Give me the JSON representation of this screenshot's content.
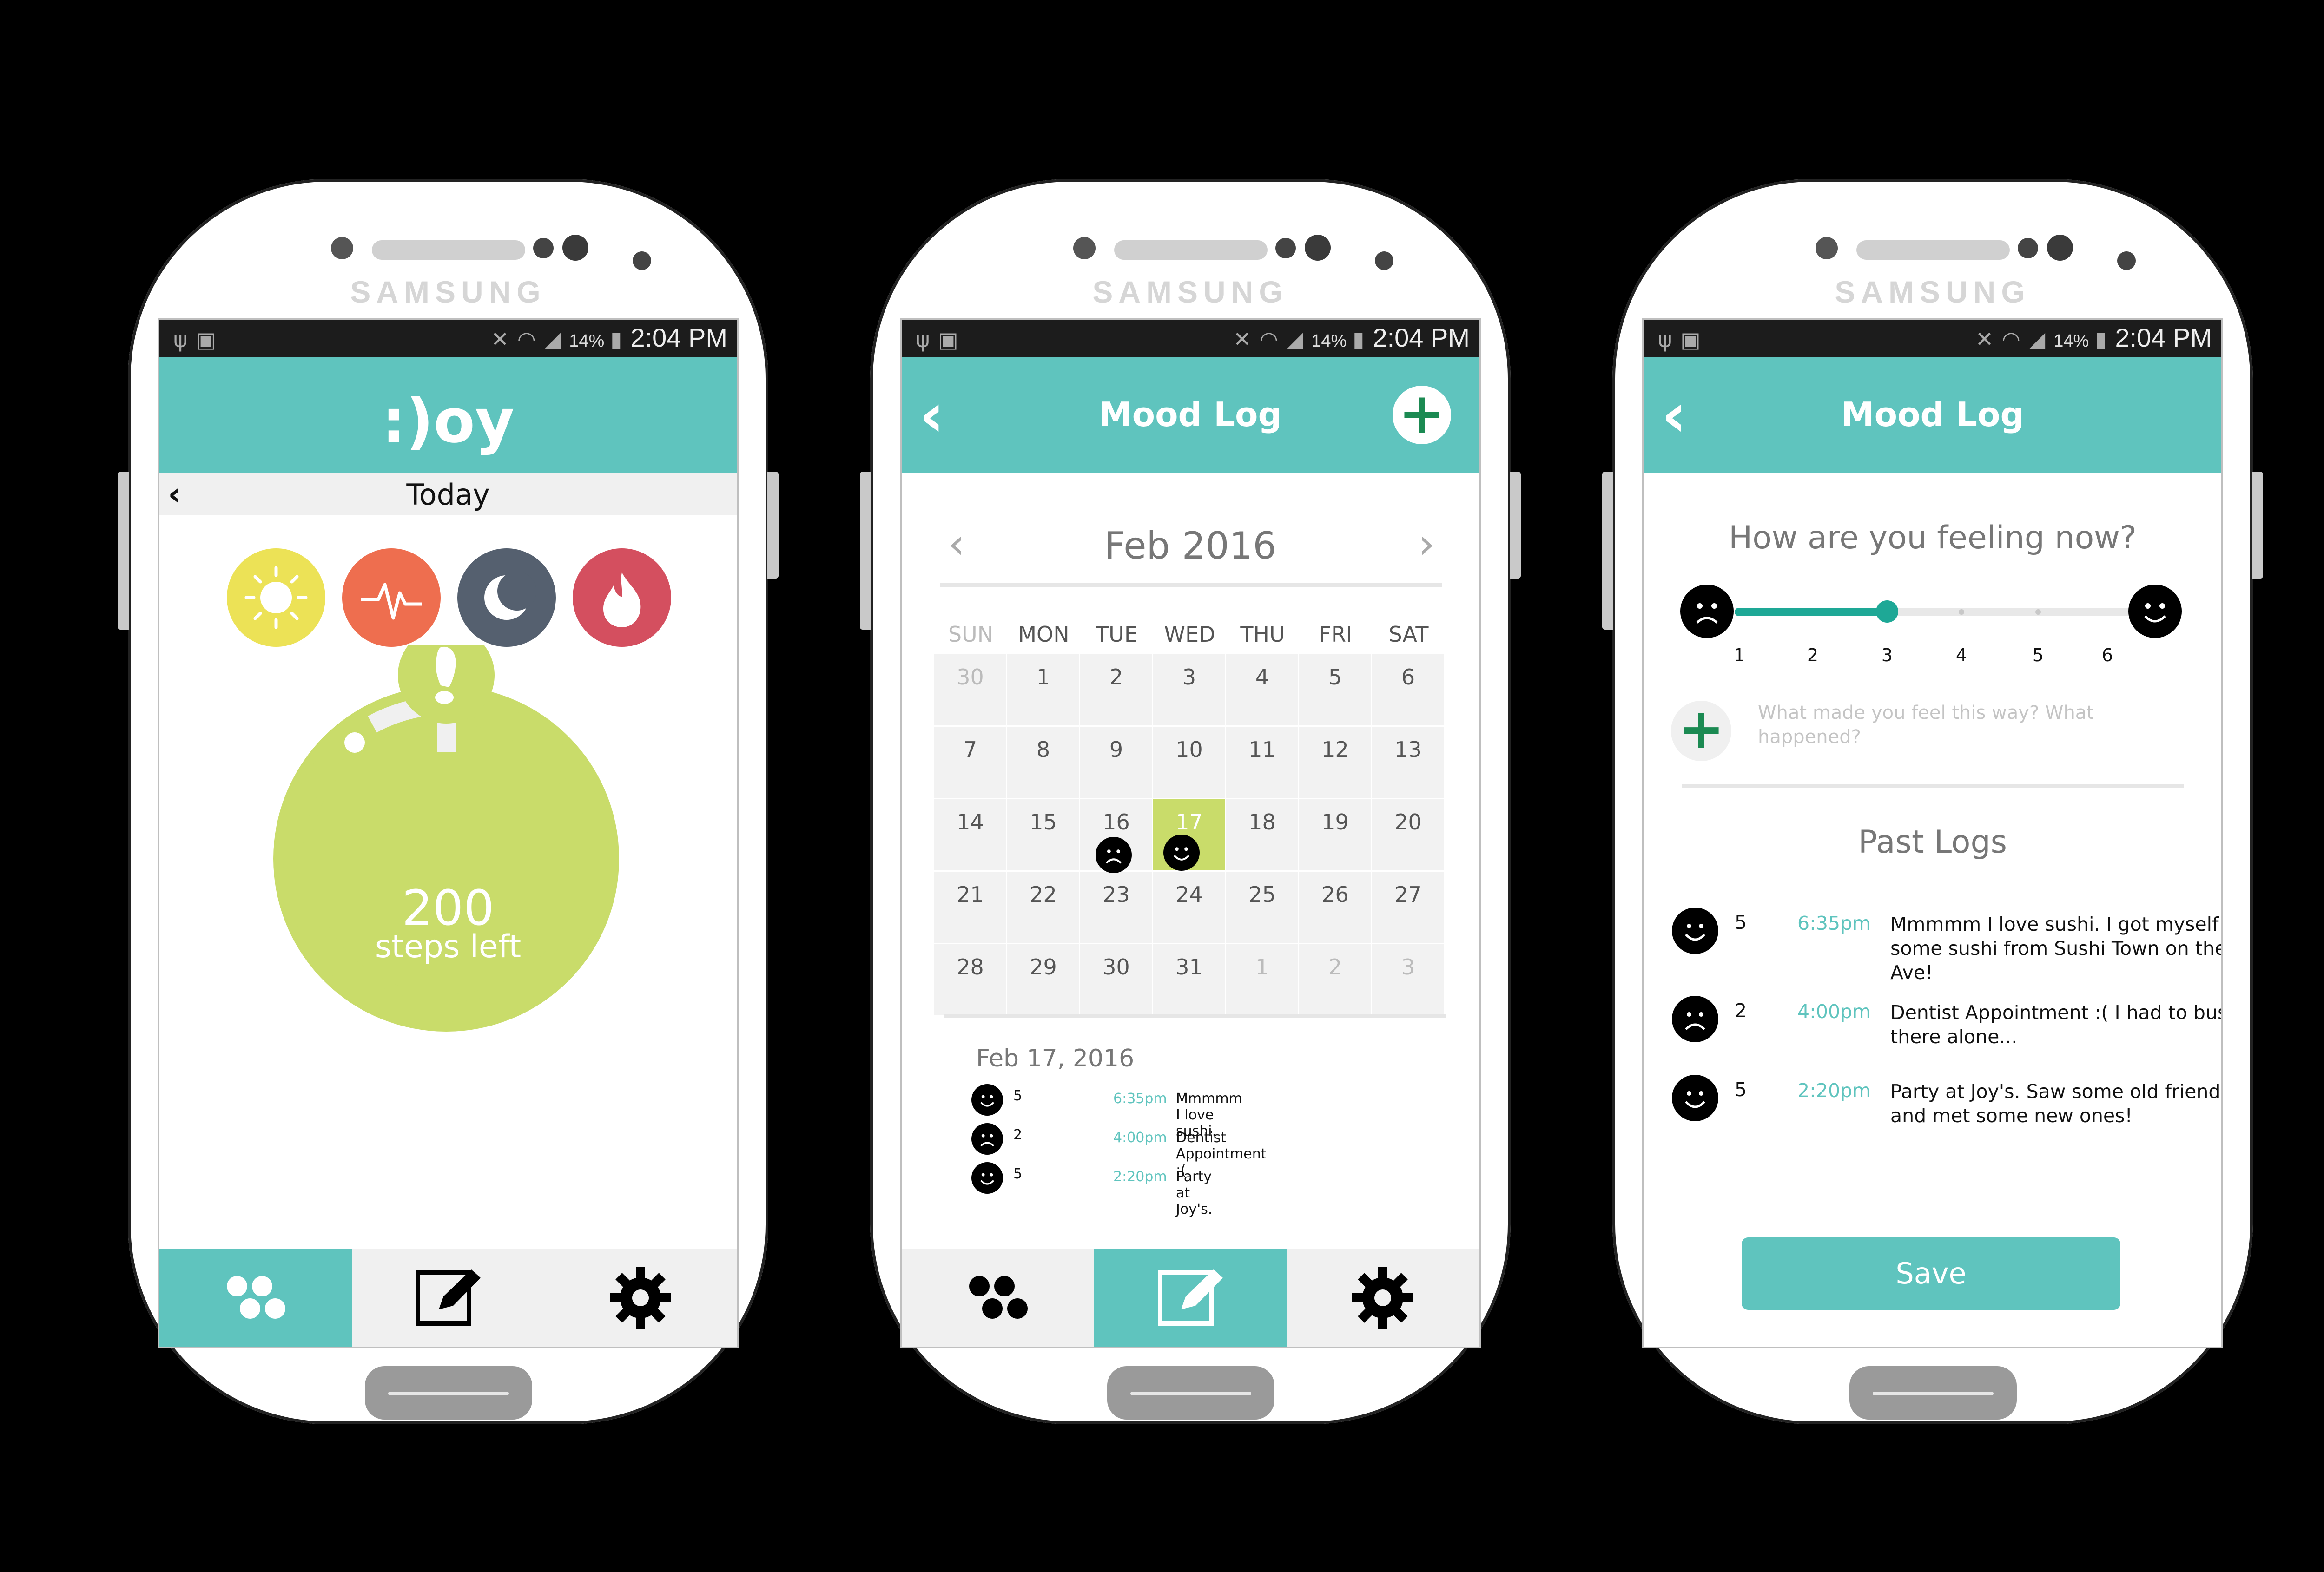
{
  "brand": "SAMSUNG",
  "status": {
    "battery": "14%",
    "time": "2:04 PM"
  },
  "screen1": {
    "logo": ":)oy",
    "today_label": "Today",
    "activity_icons": [
      {
        "name": "sun-icon",
        "color": "#ece256"
      },
      {
        "name": "heartbeat-icon",
        "color": "#ee6e4f"
      },
      {
        "name": "moon-icon",
        "color": "#55606f"
      },
      {
        "name": "flame-icon",
        "color": "#d44f5f"
      }
    ],
    "steps_value": "200",
    "steps_label": "steps left",
    "steps_progress": 0.92,
    "accent": "#c9dc6a"
  },
  "screen2": {
    "title": "Mood Log",
    "month": "Feb 2016",
    "weekdays": [
      "SUN",
      "MON",
      "TUE",
      "WED",
      "THU",
      "FRI",
      "SAT"
    ],
    "weeks": [
      [
        "30",
        "1",
        "2",
        "3",
        "4",
        "5",
        "6"
      ],
      [
        "7",
        "8",
        "9",
        "10",
        "11",
        "12",
        "13"
      ],
      [
        "14",
        "15",
        "16",
        "17",
        "18",
        "19",
        "20"
      ],
      [
        "21",
        "22",
        "23",
        "24",
        "25",
        "26",
        "27"
      ],
      [
        "28",
        "29",
        "30",
        "31",
        "1",
        "2",
        "3"
      ]
    ],
    "selected_day": "17",
    "day_title": "Feb 17, 2016",
    "entries": [
      {
        "mood": "happy",
        "rating": "5",
        "time": "6:35pm",
        "text": "Mmmmm I love sushi."
      },
      {
        "mood": "sad",
        "rating": "2",
        "time": "4:00pm",
        "text": "Dentist Appointment :("
      },
      {
        "mood": "happy",
        "rating": "5",
        "time": "2:20pm",
        "text": "Party at Joy's."
      }
    ]
  },
  "screen3": {
    "title": "Mood Log",
    "question": "How are you feeling now?",
    "scale": [
      "1",
      "2",
      "3",
      "4",
      "5",
      "6"
    ],
    "selected_value": 3,
    "prompt": "What made you feel this way? What happened?",
    "past_title": "Past Logs",
    "logs": [
      {
        "mood": "happy",
        "rating": "5",
        "time": "6:35pm",
        "text": "Mmmmm I love sushi. I got myself some sushi from Sushi Town on the Ave!"
      },
      {
        "mood": "sad",
        "rating": "2",
        "time": "4:00pm",
        "text": "Dentist Appointment :( I had to bus there alone..."
      },
      {
        "mood": "happy",
        "rating": "5",
        "time": "2:20pm",
        "text": "Party at Joy's. Saw some old friends and met some new ones!"
      }
    ],
    "save_label": "Save"
  }
}
